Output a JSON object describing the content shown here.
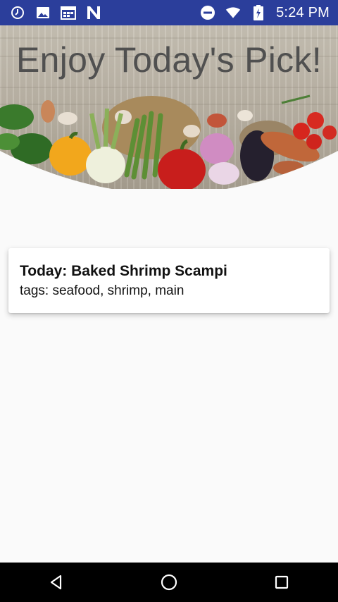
{
  "status_bar": {
    "time": "5:24 PM",
    "left_icons": [
      "clock-icon",
      "image-icon",
      "calendar-icon",
      "n-logo-icon"
    ],
    "right_icons": [
      "do-not-disturb-icon",
      "wifi-icon",
      "battery-charging-icon"
    ],
    "background_color": "#2b3e9b"
  },
  "header": {
    "title": "Enjoy Today's Pick!"
  },
  "card": {
    "title": "Today: Baked Shrimp Scampi",
    "tags": "tags: seafood, shrimp, main"
  },
  "nav_bar": {
    "buttons": [
      "back-icon",
      "home-icon",
      "recents-icon"
    ]
  }
}
